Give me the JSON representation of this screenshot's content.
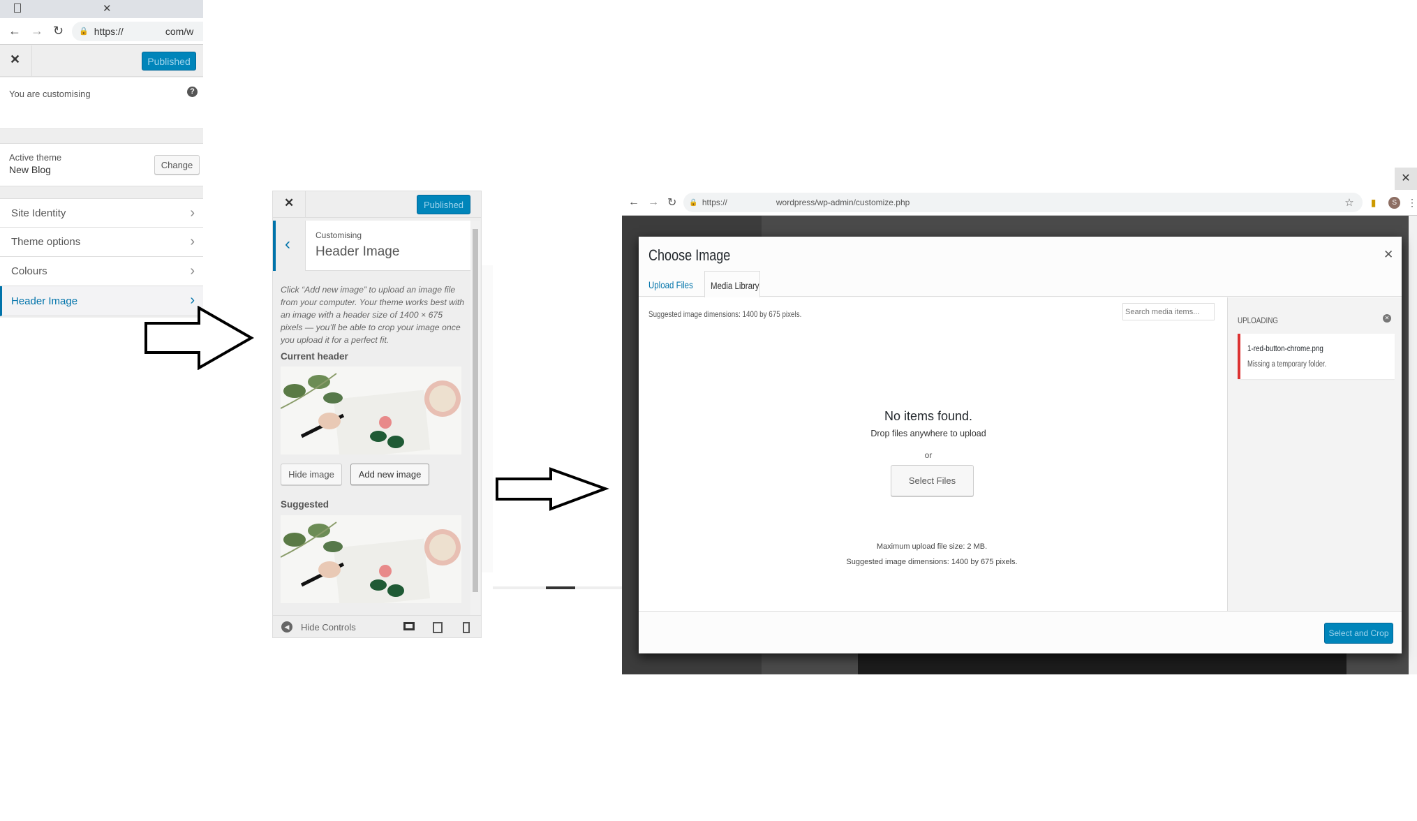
{
  "panel1": {
    "browser": {
      "url_prefix": "https://",
      "url_suffix": "com/w"
    },
    "header": {
      "published_label": "Published"
    },
    "info": {
      "customising_label": "You are customising"
    },
    "theme": {
      "label": "Active theme",
      "name": "New Blog",
      "change_label": "Change"
    },
    "menu": [
      {
        "label": "Site Identity"
      },
      {
        "label": "Theme options"
      },
      {
        "label": "Colours"
      },
      {
        "label": "Header Image",
        "active": true
      }
    ]
  },
  "panel2": {
    "header": {
      "published_label": "Published"
    },
    "section": {
      "eyebrow": "Customising",
      "title": "Header Image"
    },
    "description": "Click “Add new image” to upload an image file from your computer. Your theme works best with an image with a header size of 1400 × 675 pixels — you’ll be able to crop your image once you upload it for a perfect fit.",
    "current_header_label": "Current header",
    "hide_image_label": "Hide image",
    "add_new_image_label": "Add new image",
    "suggested_label": "Suggested",
    "footer": {
      "hide_controls_label": "Hide Controls"
    }
  },
  "panel3": {
    "browser": {
      "url_prefix": "https://",
      "url_suffix": "wordpress/wp-admin/customize.php",
      "avatar_letter": "S"
    },
    "modal": {
      "title": "Choose Image",
      "tabs": [
        {
          "label": "Upload Files"
        },
        {
          "label": "Media Library",
          "active": true
        }
      ],
      "suggested_top": "Suggested image dimensions: 1400 by 675 pixels.",
      "search_placeholder": "Search media items...",
      "empty_title": "No items found.",
      "drop_text": "Drop files anywhere to upload",
      "or_text": "or",
      "select_files_label": "Select Files",
      "max_size": "Maximum upload file size: 2 MB.",
      "suggested_bottom": "Suggested image dimensions: 1400 by 675 pixels.",
      "uploading": {
        "title": "UPLOADING",
        "filename": "1-red-button-chrome.png",
        "error": "Missing a temporary folder."
      },
      "select_crop_label": "Select and Crop"
    }
  },
  "colors": {
    "accent": "#0085ba",
    "error": "#dc3232",
    "panel_bg": "#eeeeee"
  }
}
